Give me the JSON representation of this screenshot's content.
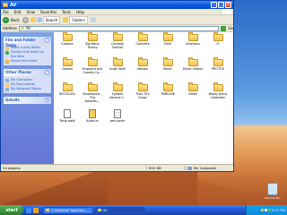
{
  "window": {
    "title": "AV",
    "menu": [
      "File",
      "Edit",
      "View",
      "Favorites",
      "Tools",
      "Help"
    ],
    "toolbar": {
      "back": "Back",
      "search": "Search",
      "folders": "Folders"
    },
    "address": {
      "label": "Address",
      "value": "AV",
      "go": "Go"
    }
  },
  "taskpane": {
    "sections": [
      {
        "title": "File and Folder Tasks",
        "items": [
          "Make a new folder",
          "Publish this folder to the Web",
          "Share this folder"
        ]
      },
      {
        "title": "Other Places",
        "items": [
          "My Computer",
          "My Documents",
          "My Network Places"
        ]
      },
      {
        "title": "Details",
        "items": []
      }
    ]
  },
  "files": [
    "Cartoon",
    "Big Bang Theory",
    "Comedy Central",
    "Concerts",
    "DivX",
    "Infamous",
    "IT",
    "Games",
    "Husband and Camels Co...",
    "Indie Stuff",
    "Movies",
    "Music",
    "Music Videos",
    "PROTOS",
    "RECYCLED",
    "Steampunk - The Adventu...",
    "System Volume I...",
    "That 70's Show",
    "TIMELINE",
    "Video",
    "Wooly Jenny Collection",
    "Tesla walk",
    "Autorun",
    "sem-anim"
  ],
  "statusbar": {
    "objects": "24 objects",
    "size": "505 KB",
    "location": "My Computer"
  },
  "desktop": {
    "recycle_bin": "Recycle Bin"
  },
  "taskbar": {
    "start": "start",
    "tasks": [
      "C:\\Software Toolchain...",
      "AV"
    ],
    "clock": "3:11 PM"
  }
}
